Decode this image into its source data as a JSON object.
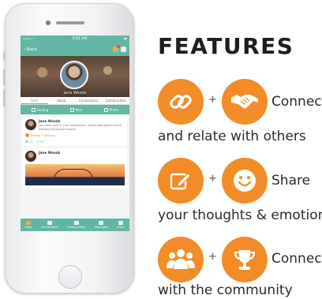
{
  "phone": {
    "status": {
      "carrier": "•••• ⌔",
      "time": "9:41 AM",
      "battery": "▬"
    },
    "nav": {
      "back_label": "‹ Back"
    },
    "profile": {
      "name": "Jane Woods"
    },
    "tabs": [
      "Feed",
      "About",
      "Connections",
      "Communities"
    ],
    "actions": [
      "Feeling",
      "Post",
      "Photo"
    ],
    "posts": [
      {
        "author": "Jane Woods",
        "text": "You need food & cute gocdewoes, special Bangalore small Rtavalot Pinterest Flawlife",
        "feeling": "feeling • @status",
        "likes": "10",
        "comments": "23"
      },
      {
        "author": "Jane Woods"
      }
    ],
    "tabbar": [
      "Feed",
      "Connections",
      "Communities",
      "Messages",
      "Menu"
    ]
  },
  "features": {
    "title": "FEATURES",
    "rows": [
      {
        "word": "Connect",
        "line": "and relate with others",
        "icon_a": "link-icon",
        "icon_b": "handshake-icon"
      },
      {
        "word": "Share",
        "line": "your thoughts & emotions",
        "icon_a": "edit-icon",
        "icon_b": "smiley-icon"
      },
      {
        "word": "Connect",
        "line": "with the community",
        "icon_a": "people-icon",
        "icon_b": "trophy-icon"
      }
    ],
    "plus": "+",
    "accent": "#f28c28"
  }
}
